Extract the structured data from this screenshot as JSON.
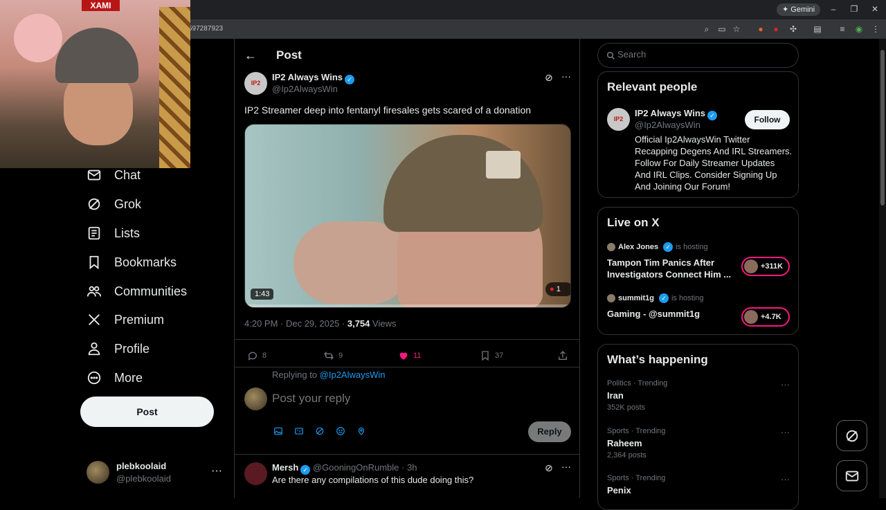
{
  "browser": {
    "gemini_label": "✦ Gemini",
    "url_fragment": "597287923"
  },
  "webcam": {
    "logo_text": "XAMI"
  },
  "nav": {
    "items": [
      {
        "label": "Chat",
        "icon": "mail-icon"
      },
      {
        "label": "Grok",
        "icon": "grok-icon"
      },
      {
        "label": "Lists",
        "icon": "list-icon"
      },
      {
        "label": "Bookmarks",
        "icon": "bookmark-icon"
      },
      {
        "label": "Communities",
        "icon": "people-icon"
      },
      {
        "label": "Premium",
        "icon": "x-icon"
      },
      {
        "label": "Profile",
        "icon": "person-icon"
      },
      {
        "label": "More",
        "icon": "more-circle-icon"
      }
    ],
    "post_label": "Post",
    "me": {
      "name": "plebkoolaid",
      "handle": "@plebkoolaid"
    }
  },
  "post": {
    "header": "Post",
    "author": {
      "name": "IP2 Always Wins",
      "handle": "@Ip2AlwaysWin",
      "avatar_text": "IP2"
    },
    "text": "IP2 Streamer deep into fentanyl firesales gets scared of a donation",
    "video": {
      "duration": "1:43",
      "live_count": "1"
    },
    "meta": {
      "time": "4:20 PM · Dec 29, 2025 · ",
      "views": "3,754",
      "views_label": " Views"
    },
    "actions": {
      "replies": "8",
      "reposts": "9",
      "likes": "11",
      "bookmarks": "37"
    },
    "colors": {
      "accent": "#1d9bf0",
      "like": "#f91880"
    }
  },
  "reply": {
    "replying_to_prefix": "Replying to ",
    "replying_to_handle": "@Ip2AlwaysWin",
    "placeholder": "Post your reply",
    "button": "Reply"
  },
  "comment": {
    "name": "Mersh",
    "handle_time": "@GooningOnRumble · 3h",
    "text": "Are there any compilations of this dude doing this?"
  },
  "sidebar": {
    "search_placeholder": "Search",
    "relevant": {
      "title": "Relevant people",
      "name": "IP2 Always Wins",
      "handle": "@Ip2AlwaysWin",
      "avatar_text": "IP2",
      "follow": "Follow",
      "bio": "Official Ip2AlwaysWin Twitter Recapping Degens And IRL Streamers. Follow For Daily Streamer Updates And IRL Clips. Consider Signing Up And Joining Our Forum!"
    },
    "live": {
      "title": "Live on X",
      "items": [
        {
          "host": "Alex Jones",
          "hosting": "is hosting",
          "title": "Tampon Tim Panics After Investigators Connect Him ...",
          "count": "+311K"
        },
        {
          "host": "summit1g",
          "hosting": "is hosting",
          "title": "Gaming - @summit1g",
          "count": "+4.7K"
        }
      ]
    },
    "happening": {
      "title": "What’s happening",
      "trends": [
        {
          "category": "Politics · Trending",
          "topic": "Iran",
          "posts": "352K posts"
        },
        {
          "category": "Sports · Trending",
          "topic": "Raheem",
          "posts": "2,364 posts"
        },
        {
          "category": "Sports · Trending",
          "topic": "Penix",
          "posts": ""
        }
      ]
    }
  }
}
